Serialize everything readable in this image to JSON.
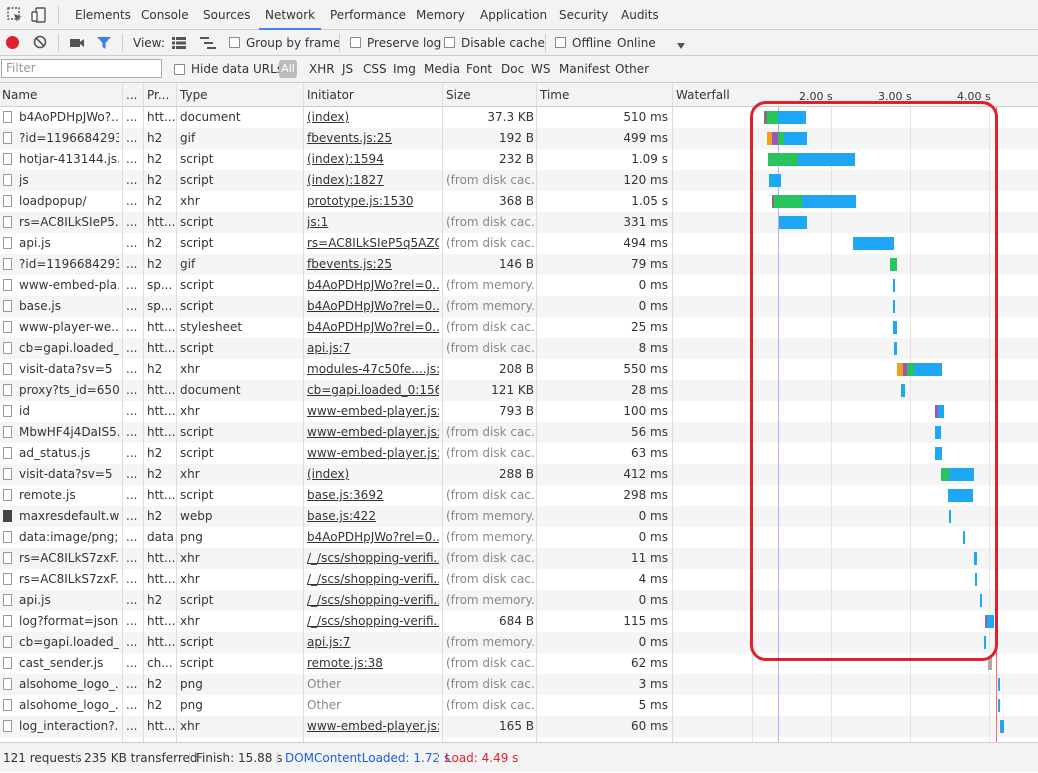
{
  "tabs": [
    "Elements",
    "Console",
    "Sources",
    "Network",
    "Performance",
    "Memory",
    "Application",
    "Security",
    "Audits"
  ],
  "active_tab": "Network",
  "toolbar": {
    "view_label": "View:",
    "group_by_frame": "Group by frame",
    "preserve_log": "Preserve log",
    "disable_cache": "Disable cache",
    "offline": "Offline",
    "throttle": "Online"
  },
  "filter": {
    "placeholder": "Filter",
    "hide_data_urls": "Hide data URLs",
    "all": "All",
    "types": [
      "XHR",
      "JS",
      "CSS",
      "Img",
      "Media",
      "Font",
      "Doc",
      "WS",
      "Manifest",
      "Other"
    ]
  },
  "columns": {
    "name": "Name",
    "dots": "...",
    "protocol": "Pr...",
    "type": "Type",
    "initiator": "Initiator",
    "size": "Size",
    "time": "Time",
    "waterfall": "Waterfall"
  },
  "waterfall_ticks": [
    "2.00 s",
    "3.00 s",
    "4.00 s"
  ],
  "rows": [
    {
      "name": "b4AoPDHpJWo?...",
      "dots": "...",
      "proto": "htt...",
      "type": "document",
      "initiator": "(index)",
      "size": "37.3 KB",
      "time": "510 ms"
    },
    {
      "name": "?id=1196684293...",
      "dots": "...",
      "proto": "h2",
      "type": "gif",
      "initiator": "fbevents.js:25",
      "size": "192 B",
      "time": "499 ms"
    },
    {
      "name": "hotjar-413144.js...",
      "dots": "...",
      "proto": "h2",
      "type": "script",
      "initiator": "(index):1594",
      "size": "232 B",
      "time": "1.09 s"
    },
    {
      "name": "js",
      "dots": "...",
      "proto": "h2",
      "type": "script",
      "initiator": "(index):1827",
      "size": "(from disk cac...",
      "time": "120 ms"
    },
    {
      "name": "loadpopup/",
      "dots": "...",
      "proto": "h2",
      "type": "xhr",
      "initiator": "prototype.js:1530",
      "size": "368 B",
      "time": "1.05 s"
    },
    {
      "name": "rs=AC8ILkSIeP5...",
      "dots": "...",
      "proto": "htt...",
      "type": "script",
      "initiator": "js:1",
      "size": "(from disk cac...",
      "time": "331 ms"
    },
    {
      "name": "api.js",
      "dots": "...",
      "proto": "h2",
      "type": "script",
      "initiator": "rs=AC8ILkSIeP5q5AZO...",
      "size": "(from disk cac...",
      "time": "494 ms"
    },
    {
      "name": "?id=1196684293...",
      "dots": "...",
      "proto": "h2",
      "type": "gif",
      "initiator": "fbevents.js:25",
      "size": "146 B",
      "time": "79 ms"
    },
    {
      "name": "www-embed-pla...",
      "dots": "...",
      "proto": "sp...",
      "type": "script",
      "initiator": "b4AoPDHpJWo?rel=0...",
      "size": "(from memory...",
      "time": "0 ms"
    },
    {
      "name": "base.js",
      "dots": "...",
      "proto": "sp...",
      "type": "script",
      "initiator": "b4AoPDHpJWo?rel=0...",
      "size": "(from memory...",
      "time": "0 ms"
    },
    {
      "name": "www-player-we...",
      "dots": "...",
      "proto": "htt...",
      "type": "stylesheet",
      "initiator": "b4AoPDHpJWo?rel=0...",
      "size": "(from disk cac...",
      "time": "25 ms"
    },
    {
      "name": "cb=gapi.loaded_0",
      "dots": "...",
      "proto": "htt...",
      "type": "script",
      "initiator": "api.js:7",
      "size": "(from disk cac...",
      "time": "8 ms"
    },
    {
      "name": "visit-data?sv=5",
      "dots": "...",
      "proto": "h2",
      "type": "xhr",
      "initiator": "modules-47c50fe....js:9",
      "size": "208 B",
      "time": "550 ms"
    },
    {
      "name": "proxy?ts_id=650...",
      "dots": "...",
      "proto": "htt...",
      "type": "document",
      "initiator": "cb=gapi.loaded_0:156",
      "size": "121 KB",
      "time": "28 ms"
    },
    {
      "name": "id",
      "dots": "...",
      "proto": "htt...",
      "type": "xhr",
      "initiator": "www-embed-player.js:...",
      "size": "793 B",
      "time": "100 ms"
    },
    {
      "name": "MbwHF4j4DaIS5...",
      "dots": "...",
      "proto": "htt...",
      "type": "script",
      "initiator": "www-embed-player.js:...",
      "size": "(from disk cac...",
      "time": "56 ms"
    },
    {
      "name": "ad_status.js",
      "dots": "...",
      "proto": "h2",
      "type": "script",
      "initiator": "www-embed-player.js:...",
      "size": "(from disk cac...",
      "time": "63 ms"
    },
    {
      "name": "visit-data?sv=5",
      "dots": "...",
      "proto": "h2",
      "type": "xhr",
      "initiator": "(index)",
      "size": "288 B",
      "time": "412 ms"
    },
    {
      "name": "remote.js",
      "dots": "...",
      "proto": "htt...",
      "type": "script",
      "initiator": "base.js:3692",
      "size": "(from disk cac...",
      "time": "298 ms"
    },
    {
      "name": "maxresdefault.w...",
      "dots": "...",
      "proto": "h2",
      "type": "webp",
      "initiator": "base.js:422",
      "size": "(from memory...",
      "time": "0 ms"
    },
    {
      "name": "data:image/png;...",
      "dots": "...",
      "proto": "data",
      "type": "png",
      "initiator": "b4AoPDHpJWo?rel=0...",
      "size": "(from memory...",
      "time": "0 ms"
    },
    {
      "name": "rs=AC8ILkS7zxF...",
      "dots": "...",
      "proto": "htt...",
      "type": "xhr",
      "initiator": "/_/scs/shopping-verifi...",
      "size": "(from disk cac...",
      "time": "11 ms"
    },
    {
      "name": "rs=AC8ILkS7zxF...",
      "dots": "...",
      "proto": "htt...",
      "type": "xhr",
      "initiator": "/_/scs/shopping-verifi...",
      "size": "(from disk cac...",
      "time": "4 ms"
    },
    {
      "name": "api.js",
      "dots": "...",
      "proto": "h2",
      "type": "script",
      "initiator": "/_/scs/shopping-verifi...",
      "size": "(from memory...",
      "time": "0 ms"
    },
    {
      "name": "log?format=json",
      "dots": "...",
      "proto": "htt...",
      "type": "xhr",
      "initiator": "/_/scs/shopping-verifi...",
      "size": "684 B",
      "time": "115 ms"
    },
    {
      "name": "cb=gapi.loaded_0",
      "dots": "...",
      "proto": "htt...",
      "type": "script",
      "initiator": "api.js:7",
      "size": "(from memory...",
      "time": "0 ms"
    },
    {
      "name": "cast_sender.js",
      "dots": "...",
      "proto": "ch...",
      "type": "script",
      "initiator": "remote.js:38",
      "size": "(from disk cac...",
      "time": "62 ms"
    },
    {
      "name": "alsohome_logo_...",
      "dots": "...",
      "proto": "h2",
      "type": "png",
      "initiator": "Other",
      "size": "(from disk cac...",
      "time": "3 ms"
    },
    {
      "name": "alsohome_logo_...",
      "dots": "...",
      "proto": "h2",
      "type": "png",
      "initiator": "Other",
      "size": "(from disk cac...",
      "time": "5 ms"
    },
    {
      "name": "log_interaction?...",
      "dots": "...",
      "proto": "htt...",
      "type": "xhr",
      "initiator": "www-embed-player.js:...",
      "size": "165 B",
      "time": "60 ms"
    }
  ],
  "status": {
    "requests": "121 requests",
    "transferred": "235 KB transferred",
    "finish": "Finish: 15.88 s",
    "dom_content_loaded": "DOMContentLoaded: 1.72 s",
    "load": "Load: 4.49 s"
  },
  "colors": {
    "tab_underline": "#4285f4",
    "bar_receive": "#1ea7f4",
    "bar_wait": "#28c45c",
    "bar_ssl": "#9b59b6",
    "bar_connect": "#f0a020",
    "dom_line": "#0000ff",
    "load_line": "#ff0000",
    "highlight": "#e0212b"
  }
}
